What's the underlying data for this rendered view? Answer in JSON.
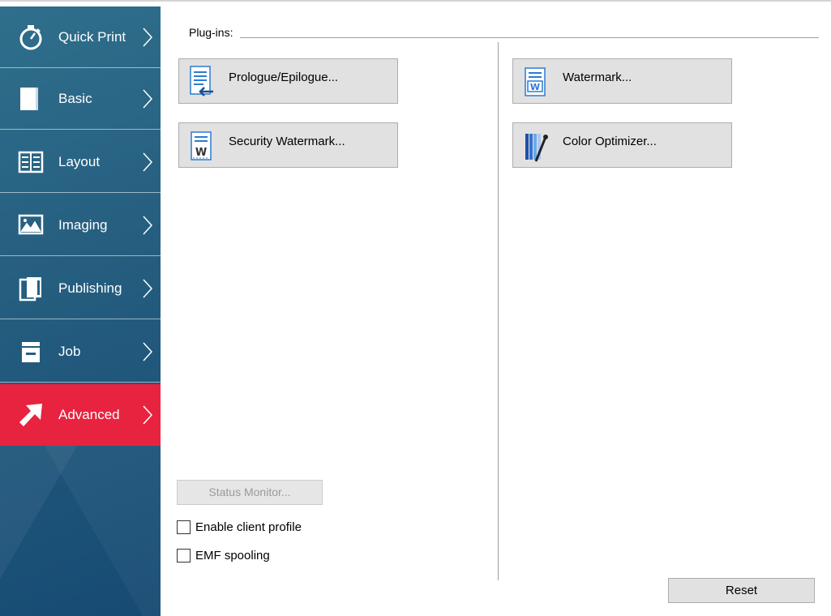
{
  "sidebar": {
    "items": [
      {
        "label": "Quick Print",
        "icon": "stopwatch-icon",
        "active": false
      },
      {
        "label": "Basic",
        "icon": "page-icon",
        "active": false
      },
      {
        "label": "Layout",
        "icon": "layout-grid-icon",
        "active": false
      },
      {
        "label": "Imaging",
        "icon": "image-icon",
        "active": false
      },
      {
        "label": "Publishing",
        "icon": "documents-icon",
        "active": false
      },
      {
        "label": "Job",
        "icon": "printer-tray-icon",
        "active": false
      },
      {
        "label": "Advanced",
        "icon": "arrow-up-right-icon",
        "active": true
      }
    ],
    "colors": {
      "background": "#265f80",
      "active": "#e8233f"
    }
  },
  "plugins": {
    "label": "Plug-ins:",
    "buttons": [
      {
        "label": "Prologue/Epilogue...",
        "icon": "document-insert-icon"
      },
      {
        "label": "Security Watermark...",
        "icon": "security-watermark-icon"
      },
      {
        "label": "Watermark...",
        "icon": "watermark-icon"
      },
      {
        "label": "Color Optimizer...",
        "icon": "color-optimizer-icon"
      }
    ]
  },
  "status_monitor": {
    "label": "Status Monitor...",
    "enabled": false
  },
  "options": [
    {
      "label": "Enable client profile",
      "checked": false
    },
    {
      "label": "EMF spooling",
      "checked": false
    }
  ],
  "reset": {
    "label": "Reset"
  }
}
